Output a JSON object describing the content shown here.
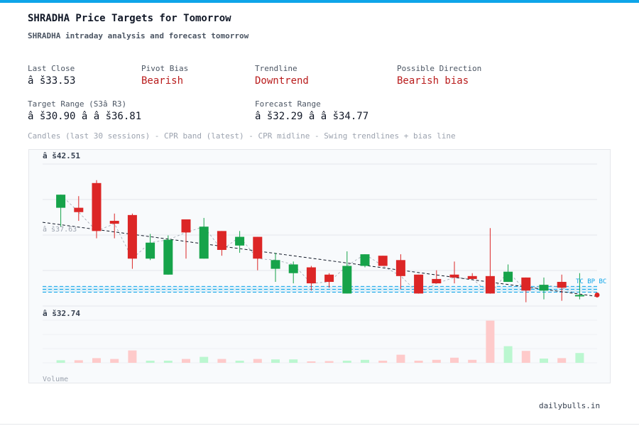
{
  "header": {
    "title": "SHRADHA Price Targets for Tomorrow",
    "subtitle": "SHRADHA intraday analysis and forecast tomorrow"
  },
  "stats": {
    "last_close": {
      "label": "Last Close",
      "value": "â š33.53"
    },
    "pivot_bias": {
      "label": "Pivot Bias",
      "value": "Bearish"
    },
    "trendline": {
      "label": "Trendline",
      "value": "Downtrend"
    },
    "direction": {
      "label": "Possible Direction",
      "value": "Bearish bias"
    },
    "target_range": {
      "label": "Target Range (S3â  R3)",
      "value": "â š30.90 â    â š36.81"
    },
    "forecast_range": {
      "label": "Forecast Range",
      "value": "â š32.29 â    â š34.77"
    }
  },
  "chart_caption": "Candles (last 30 sessions) - CPR band (latest) - CPR midline - Swing trendlines + bias line",
  "footer": {
    "brand": "dailybulls.in"
  },
  "colors": {
    "bull": "#16a34a",
    "bear": "#dc2626",
    "bull_volume": "#bbf7d0",
    "bear_volume": "#fecaca",
    "cpr": "#0ea5e9",
    "accent": "#0ea5e9"
  },
  "chart_data": {
    "type": "candlestick",
    "yaxis_labels": {
      "top": "â š42.51",
      "mid": "â š37.63",
      "bottom": "â š32.74"
    },
    "ylim": [
      32.74,
      42.51
    ],
    "volume_label": "Volume",
    "cpr_band": {
      "top": 34.09,
      "mid": 33.89,
      "bottom": 33.69
    },
    "cpr_tag": "TC BP BC",
    "trendline": {
      "start": 38.5,
      "end": 33.4
    },
    "candles": [
      {
        "open": 39.5,
        "high": 40.2,
        "low": 38.2,
        "close": 40.4,
        "volume": 0.06
      },
      {
        "open": 39.5,
        "high": 40.3,
        "low": 38.6,
        "close": 39.2,
        "volume": 0.06
      },
      {
        "open": 41.2,
        "high": 41.4,
        "low": 37.4,
        "close": 37.9,
        "volume": 0.11
      },
      {
        "open": 38.6,
        "high": 39.1,
        "low": 37.4,
        "close": 38.4,
        "volume": 0.09
      },
      {
        "open": 39.0,
        "high": 39.1,
        "low": 35.3,
        "close": 36.0,
        "volume": 0.29
      },
      {
        "open": 36.0,
        "high": 37.7,
        "low": 35.9,
        "close": 37.1,
        "volume": 0.05
      },
      {
        "open": 34.9,
        "high": 37.6,
        "low": 34.9,
        "close": 37.3,
        "volume": 0.05
      },
      {
        "open": 38.7,
        "high": 38.7,
        "low": 36.0,
        "close": 37.8,
        "volume": 0.09
      },
      {
        "open": 36.0,
        "high": 38.8,
        "low": 36.0,
        "close": 38.2,
        "volume": 0.14
      },
      {
        "open": 37.9,
        "high": 37.9,
        "low": 36.2,
        "close": 36.6,
        "volume": 0.09
      },
      {
        "open": 36.9,
        "high": 37.9,
        "low": 36.4,
        "close": 37.5,
        "volume": 0.05
      },
      {
        "open": 37.5,
        "high": 37.5,
        "low": 35.2,
        "close": 36.0,
        "volume": 0.09
      },
      {
        "open": 35.3,
        "high": 36.4,
        "low": 34.4,
        "close": 35.9,
        "volume": 0.08
      },
      {
        "open": 35.0,
        "high": 35.8,
        "low": 34.3,
        "close": 35.6,
        "volume": 0.08
      },
      {
        "open": 35.4,
        "high": 35.5,
        "low": 33.8,
        "close": 34.3,
        "volume": 0.03
      },
      {
        "open": 34.9,
        "high": 35.0,
        "low": 34.0,
        "close": 34.4,
        "volume": 0.04
      },
      {
        "open": 33.6,
        "high": 36.5,
        "low": 33.6,
        "close": 35.5,
        "volume": 0.05
      },
      {
        "open": 35.5,
        "high": 36.3,
        "low": 35.4,
        "close": 36.3,
        "volume": 0.07
      },
      {
        "open": 36.2,
        "high": 36.2,
        "low": 35.5,
        "close": 35.5,
        "volume": 0.05
      },
      {
        "open": 35.9,
        "high": 36.3,
        "low": 33.9,
        "close": 34.8,
        "volume": 0.19
      },
      {
        "open": 34.9,
        "high": 34.9,
        "low": 33.6,
        "close": 33.6,
        "volume": 0.05
      },
      {
        "open": 34.6,
        "high": 35.2,
        "low": 34.4,
        "close": 34.3,
        "volume": 0.07
      },
      {
        "open": 34.9,
        "high": 35.8,
        "low": 34.3,
        "close": 34.7,
        "volume": 0.12
      },
      {
        "open": 34.8,
        "high": 35.0,
        "low": 34.6,
        "close": 34.6,
        "volume": 0.07
      },
      {
        "open": 34.8,
        "high": 38.1,
        "low": 33.9,
        "close": 33.6,
        "volume": 0.99
      },
      {
        "open": 34.4,
        "high": 35.6,
        "low": 34.4,
        "close": 35.1,
        "volume": 0.39
      },
      {
        "open": 34.7,
        "high": 34.7,
        "low": 33.0,
        "close": 33.8,
        "volume": 0.28
      },
      {
        "open": 33.8,
        "high": 34.7,
        "low": 33.2,
        "close": 34.2,
        "volume": 0.1
      },
      {
        "open": 34.4,
        "high": 34.9,
        "low": 33.1,
        "close": 34.0,
        "volume": 0.11
      },
      {
        "open": 33.5,
        "high": 35.0,
        "low": 33.2,
        "close": 33.5,
        "volume": 0.23
      }
    ]
  }
}
